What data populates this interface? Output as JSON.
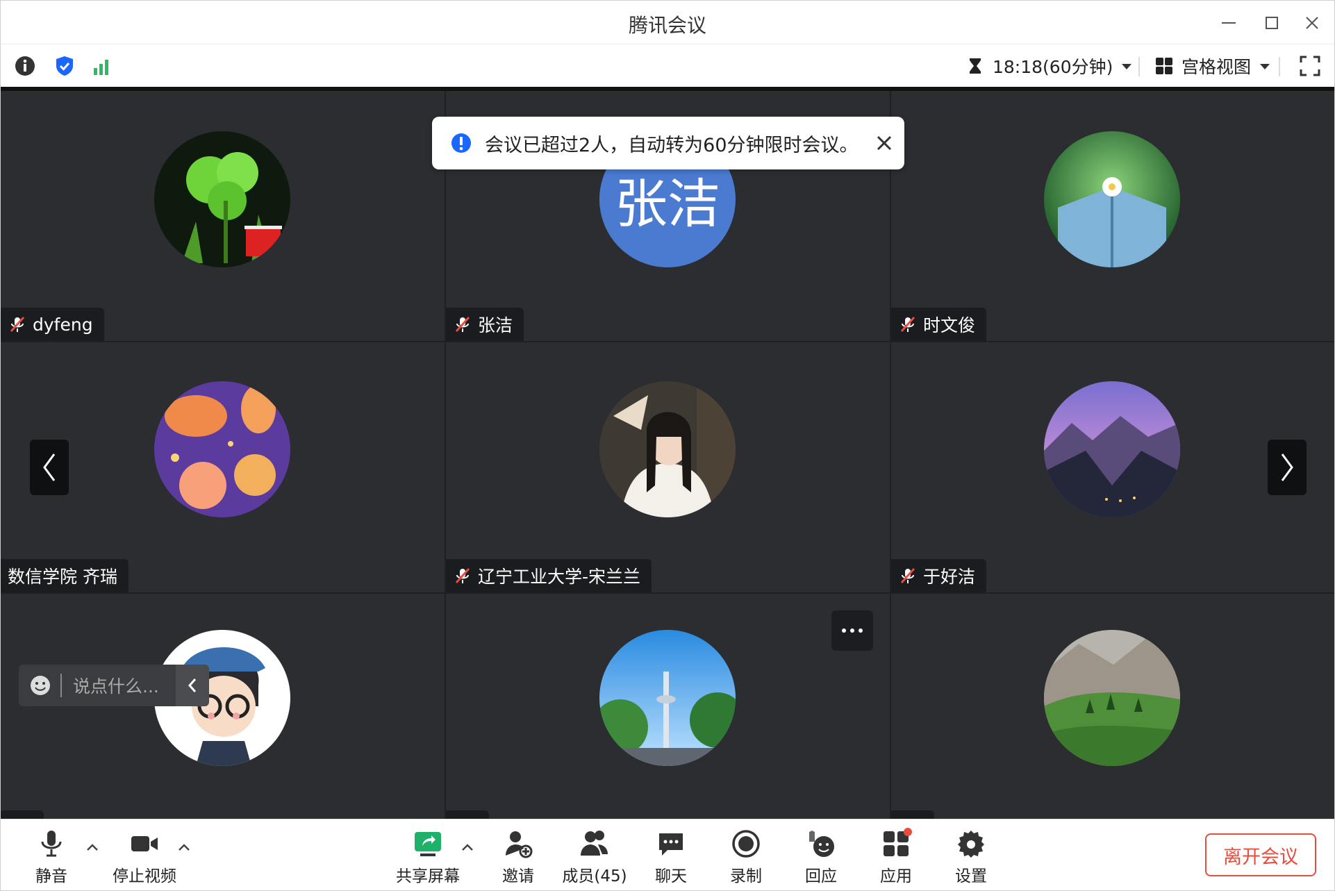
{
  "window": {
    "title": "腾讯会议"
  },
  "infobar": {
    "timer_text": "18:18(60分钟)",
    "view_label": "宫格视图"
  },
  "toast": {
    "message": "会议已超过2人，自动转为60分钟限时会议。"
  },
  "participants": [
    {
      "name": "dyfeng",
      "muted": true
    },
    {
      "name": "张洁",
      "muted": true,
      "avatar_text": "张洁",
      "avatar_color": "#4a7bd0"
    },
    {
      "name": "时文俊",
      "muted": true
    },
    {
      "name": "数信学院 齐瑞",
      "muted": false
    },
    {
      "name": "辽宁工业大学-宋兰兰",
      "muted": true
    },
    {
      "name": "于好洁",
      "muted": true
    },
    {
      "name": "",
      "muted": true
    },
    {
      "name": "",
      "muted": true
    },
    {
      "name": "",
      "muted": true
    }
  ],
  "chat": {
    "placeholder": "说点什么..."
  },
  "toolbar": {
    "mute": "静音",
    "stop_video": "停止视频",
    "share_screen": "共享屏幕",
    "invite": "邀请",
    "members": "成员(45)",
    "chat": "聊天",
    "record": "录制",
    "reaction": "回应",
    "apps": "应用",
    "settings": "设置",
    "leave": "离开会议"
  },
  "colors": {
    "accent": "#1a66ff",
    "danger": "#e84c3d",
    "tile_bg": "#2b2d31",
    "signal": "#2fb866"
  }
}
